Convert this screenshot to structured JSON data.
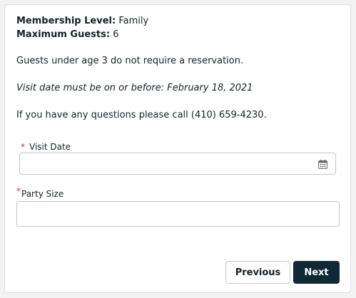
{
  "info": {
    "membership_label": "Membership Level:",
    "membership_value": "Family",
    "max_guests_label": "Maximum Guests:",
    "max_guests_value": "6",
    "under_three_note": "Guests under age 3 do not require a reservation.",
    "visit_deadline_note": "Visit date must be on or before: February 18, 2021",
    "contact_note": "If you have any questions please call (410) 659-4230."
  },
  "form": {
    "required_marker": "*",
    "visit_date": {
      "label": "Visit Date",
      "value": "",
      "icon": "calendar-icon"
    },
    "party_size": {
      "label": "Party Size",
      "value": ""
    }
  },
  "actions": {
    "previous_label": "Previous",
    "next_label": "Next"
  },
  "colors": {
    "required": "#c23934",
    "primary_button": "#0f2a35",
    "text": "#16202a",
    "border": "#c9c7c5"
  }
}
